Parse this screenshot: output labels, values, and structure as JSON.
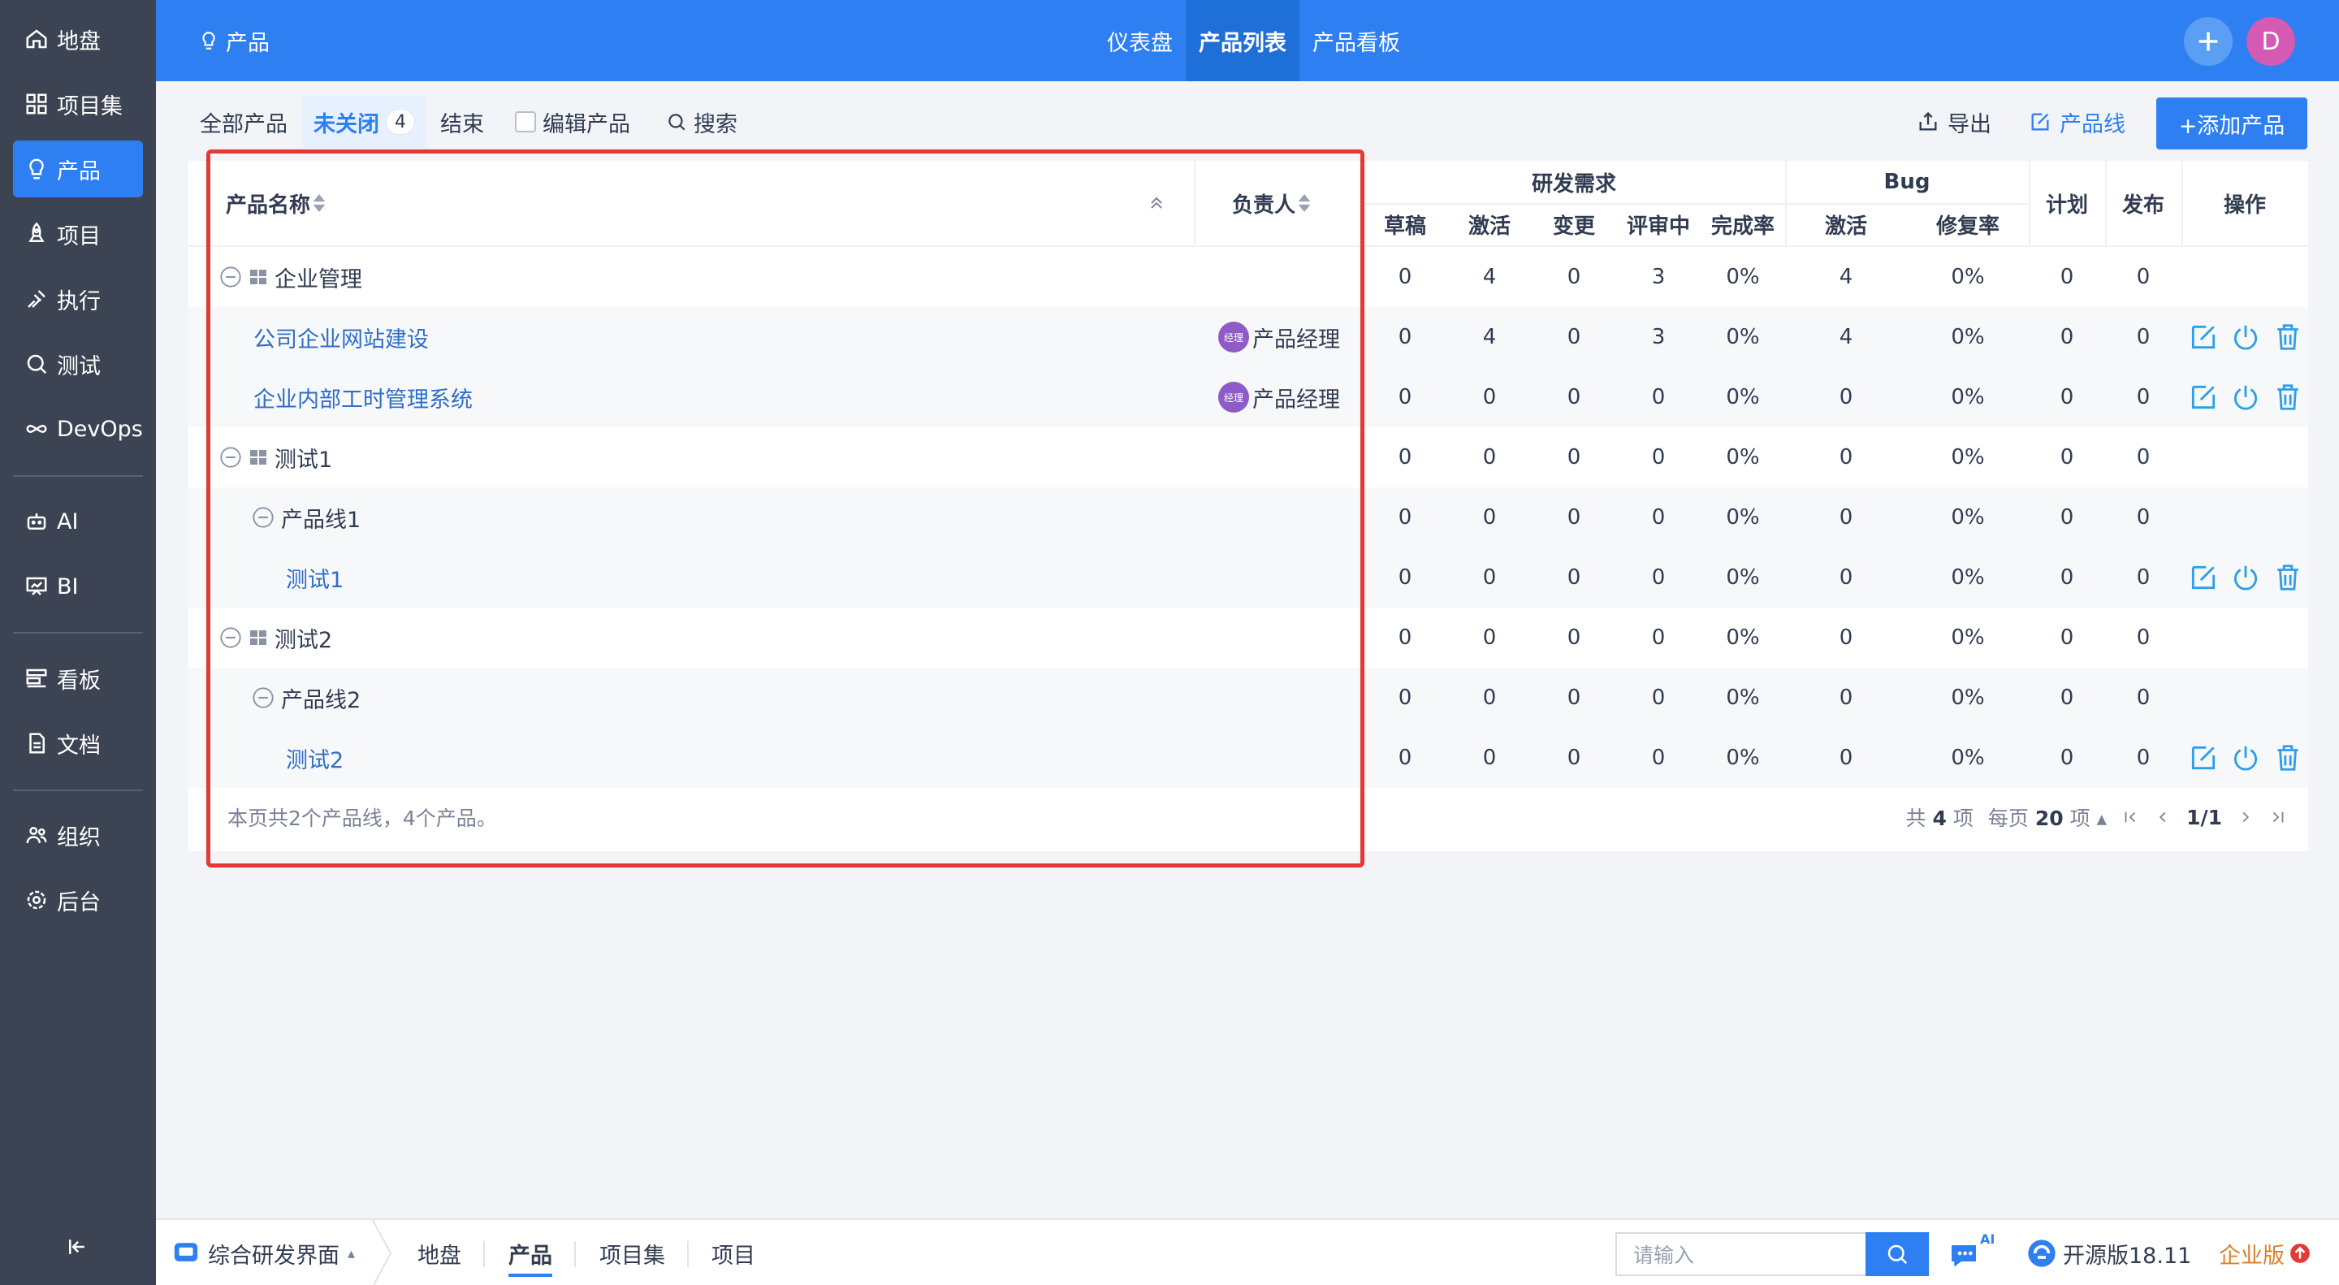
{
  "sidebar": {
    "items": [
      {
        "label": "地盘",
        "icon": "home-icon"
      },
      {
        "label": "项目集",
        "icon": "grid-icon"
      },
      {
        "label": "产品",
        "icon": "bulb-icon"
      },
      {
        "label": "项目",
        "icon": "rocket-icon"
      },
      {
        "label": "执行",
        "icon": "run-icon"
      },
      {
        "label": "测试",
        "icon": "search-icon"
      },
      {
        "label": "DevOps",
        "icon": "infinity-icon"
      },
      {
        "label": "AI",
        "icon": "robot-icon"
      },
      {
        "label": "BI",
        "icon": "chart-board-icon"
      },
      {
        "label": "看板",
        "icon": "kanban-icon"
      },
      {
        "label": "文档",
        "icon": "doc-icon"
      },
      {
        "label": "组织",
        "icon": "people-icon"
      },
      {
        "label": "后台",
        "icon": "gear-icon"
      }
    ]
  },
  "header": {
    "app_name": "产品",
    "tabs": [
      "仪表盘",
      "产品列表",
      "产品看板"
    ],
    "avatar_letter": "D"
  },
  "toolbar": {
    "all_products": "全部产品",
    "unclosed": "未关闭",
    "unclosed_count": "4",
    "closed": "结束",
    "edit_products": "编辑产品",
    "search": "搜索",
    "export": "导出",
    "product_line": "产品线",
    "add_product": "+添加产品"
  },
  "table": {
    "col_name": "产品名称",
    "col_owner": "负责人",
    "group_story": "研发需求",
    "group_bug": "Bug",
    "story_cols": [
      "草稿",
      "激活",
      "变更",
      "评审中",
      "完成率"
    ],
    "bug_cols": [
      "激活",
      "修复率"
    ],
    "col_plan": "计划",
    "col_release": "发布",
    "col_actions": "操作",
    "rows": [
      {
        "name": "企业管理",
        "owner": "",
        "values": [
          "0",
          "4",
          "0",
          "3",
          "0%",
          "4",
          "0%",
          "0",
          "0"
        ]
      },
      {
        "name": "公司企业网站建设",
        "owner": "产品经理",
        "values": [
          "0",
          "4",
          "0",
          "3",
          "0%",
          "4",
          "0%",
          "0",
          "0"
        ]
      },
      {
        "name": "企业内部工时管理系统",
        "owner": "产品经理",
        "values": [
          "0",
          "0",
          "0",
          "0",
          "0%",
          "0",
          "0%",
          "0",
          "0"
        ]
      },
      {
        "name": "测试1",
        "owner": "",
        "values": [
          "0",
          "0",
          "0",
          "0",
          "0%",
          "0",
          "0%",
          "0",
          "0"
        ]
      },
      {
        "name": "产品线1",
        "owner": "",
        "values": [
          "0",
          "0",
          "0",
          "0",
          "0%",
          "0",
          "0%",
          "0",
          "0"
        ]
      },
      {
        "name": "测试1",
        "owner": "",
        "values": [
          "0",
          "0",
          "0",
          "0",
          "0%",
          "0",
          "0%",
          "0",
          "0"
        ]
      },
      {
        "name": "测试2",
        "owner": "",
        "values": [
          "0",
          "0",
          "0",
          "0",
          "0%",
          "0",
          "0%",
          "0",
          "0"
        ]
      },
      {
        "name": "产品线2",
        "owner": "",
        "values": [
          "0",
          "0",
          "0",
          "0",
          "0%",
          "0",
          "0%",
          "0",
          "0"
        ]
      },
      {
        "name": "测试2",
        "owner": "",
        "values": [
          "0",
          "0",
          "0",
          "0",
          "0%",
          "0",
          "0%",
          "0",
          "0"
        ]
      }
    ],
    "owner_avatar_text": "经理",
    "footer_note": "本页共2个产品线，4个产品。",
    "pager": {
      "total_prefix": "共",
      "total": "4",
      "total_suffix": "项",
      "per_page_prefix": "每页",
      "per_page": "20",
      "per_page_suffix": "项",
      "page": "1/1"
    }
  },
  "bottombar": {
    "workspace": "综合研发界面",
    "items": [
      "地盘",
      "产品",
      "项目集",
      "项目"
    ],
    "search_placeholder": "请输入",
    "ai_badge": "AI",
    "version": "开源版18.11",
    "edition": "企业版"
  },
  "colors": {
    "primary": "#2e7ff2",
    "sidebar_bg": "#3c4353",
    "highlight_border": "#e53935",
    "link": "#2e6ec7"
  }
}
